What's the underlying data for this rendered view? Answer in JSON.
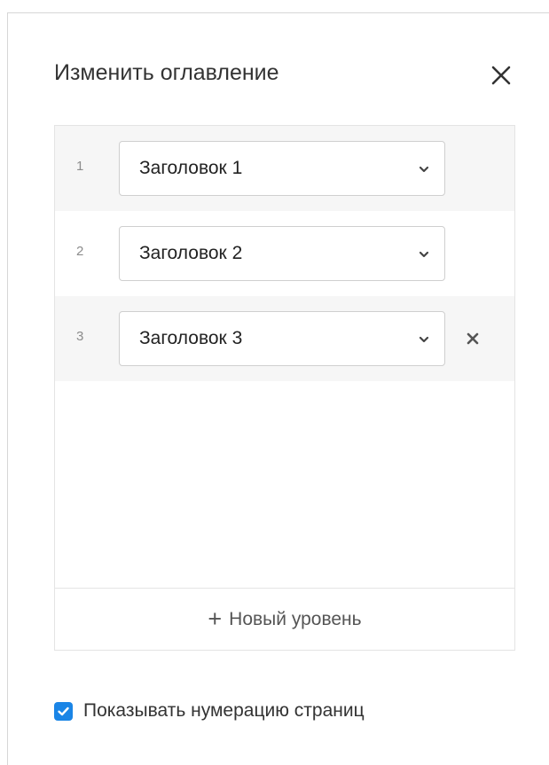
{
  "dialog": {
    "title": "Изменить оглавление",
    "close_icon": "close-icon"
  },
  "levels": [
    {
      "number": "1",
      "value": "Заголовок 1"
    },
    {
      "number": "2",
      "value": "Заголовок 2"
    },
    {
      "number": "3",
      "value": "Заголовок 3",
      "removable": true
    }
  ],
  "add_level": {
    "icon": "plus-icon",
    "label": "Новый уровень"
  },
  "show_page_numbers": {
    "label": "Показывать нумерацию страниц",
    "checked": true
  },
  "colors": {
    "accent": "#1a85e6",
    "row_shade": "#f6f6f6"
  }
}
